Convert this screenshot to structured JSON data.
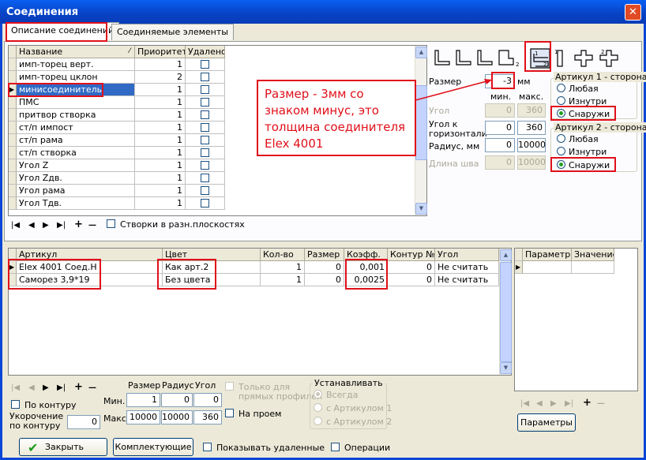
{
  "window": {
    "title": "Соединения",
    "close": "✕"
  },
  "tabs": [
    {
      "label": "Описание соединений",
      "active": true
    },
    {
      "label": "Соединяемые элементы",
      "active": false
    }
  ],
  "connections_grid": {
    "headers": [
      "Название",
      "Приоритет",
      "Удалено"
    ],
    "rows": [
      {
        "name": "имп-торец верт.",
        "priority": "1",
        "selected": false
      },
      {
        "name": "имп-торец цклон",
        "priority": "2",
        "selected": false
      },
      {
        "name": "минисоединитель",
        "priority": "1",
        "selected": true
      },
      {
        "name": "ПМС",
        "priority": "1",
        "selected": false
      },
      {
        "name": "притвор створка",
        "priority": "1",
        "selected": false
      },
      {
        "name": "ст/п импост",
        "priority": "1",
        "selected": false
      },
      {
        "name": "ст/п рама",
        "priority": "1",
        "selected": false
      },
      {
        "name": "ст/п створка",
        "priority": "1",
        "selected": false
      },
      {
        "name": "Угол Z",
        "priority": "1",
        "selected": false
      },
      {
        "name": "Угол Zдв.",
        "priority": "1",
        "selected": false
      },
      {
        "name": "Угол рама",
        "priority": "1",
        "selected": false
      },
      {
        "name": "Угол Тдв.",
        "priority": "1",
        "selected": false
      }
    ]
  },
  "nav_top": {
    "first": "|◀",
    "prev": "◀",
    "next": "▶",
    "last": "▶|",
    "add": "+",
    "remove": "—",
    "checkbox_label": "Створки в разн.плоскостях"
  },
  "annotation": {
    "text": "Размер - 3мм со знаком минус, это толщина соединителя Elex 4001",
    "color": "#e0101a"
  },
  "params": {
    "size_label": "Размер",
    "size_value": "-3",
    "mm": "мм",
    "min_label": "мин.",
    "max_label": "макс.",
    "angle_label": "Угол",
    "angle_min": "0",
    "angle_max": "360",
    "horiz_label_1": "Угол к",
    "horiz_label_2": "горизонтали",
    "horiz_min": "0",
    "horiz_max": "360",
    "radius_label": "Радиус, мм",
    "radius_min": "0",
    "radius_max": "10000",
    "seam_label": "Длина шва",
    "seam_min": "0",
    "seam_max": "10000"
  },
  "side1": {
    "title": "Артикул 1 - сторона",
    "options": [
      "Любая",
      "Изнутри",
      "Снаружи"
    ],
    "selected": 2
  },
  "side2": {
    "title": "Артикул 2 - сторона",
    "options": [
      "Любая",
      "Изнутри",
      "Снаружи"
    ],
    "selected": 2
  },
  "articles_grid": {
    "headers": [
      "Артикул",
      "Цвет",
      "Кол-во",
      "Размер",
      "Коэфф.",
      "Контур №",
      "Угол"
    ],
    "rows": [
      {
        "article": "Elex 4001 Соед.Н",
        "color": "Как арт.2",
        "qty": "1",
        "size": "0",
        "coef": "0,001",
        "contour": "0",
        "angle": "Не считать"
      },
      {
        "article": "Саморез 3,9*19",
        "color": "Без цвета",
        "qty": "1",
        "size": "0",
        "coef": "0,0025",
        "contour": "0",
        "angle": "Не считать"
      }
    ]
  },
  "param_grid": {
    "headers": [
      "Параметр",
      "Значение"
    ]
  },
  "bottom": {
    "size_hdr": "Размер",
    "radius_hdr": "Радиус",
    "angle_hdr": "Угол",
    "min_label": "Мин.",
    "max_label": "Макс.",
    "min_size": "1",
    "min_radius": "0",
    "min_angle": "0",
    "max_size": "10000",
    "max_radius": "10000",
    "max_angle": "360",
    "by_contour": "По контуру",
    "shorten_1": "Укорочение",
    "shorten_2": "по контуру",
    "shorten_value": "0",
    "only_straight_1": "Только для",
    "only_straight_2": "прямых профилей",
    "on_seam": "На проем",
    "install_title": "Устанавливать",
    "install_options": [
      "Всегда",
      "с Артикулом 1",
      "с Артикулом 2"
    ],
    "params_button": "Параметры",
    "close_button": "Закрыть",
    "components_button": "Комплектующие",
    "show_deleted": "Показывать удаленные",
    "operations": "Операции"
  },
  "icon_labels": {
    "a": "1",
    "b": "2"
  }
}
